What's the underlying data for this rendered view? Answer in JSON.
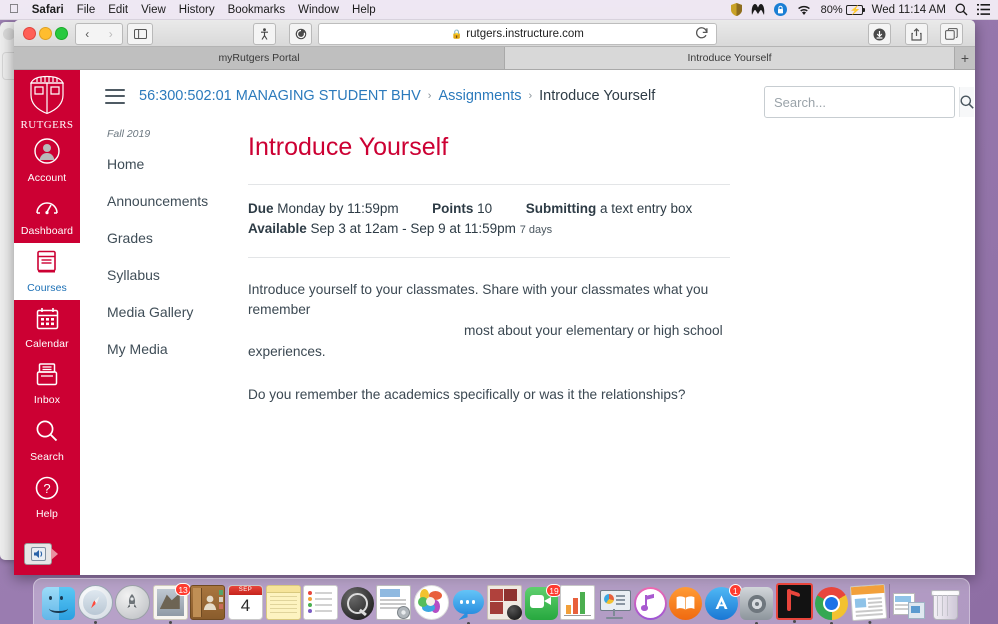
{
  "menubar": {
    "apple": "apple-logo",
    "items": [
      "Safari",
      "File",
      "Edit",
      "View",
      "History",
      "Bookmarks",
      "Window",
      "Help"
    ],
    "status": {
      "battery_percent": "80%",
      "clock": "Wed 11:14 AM",
      "icons": [
        "shield-icon",
        "malwarebytes-icon",
        "security-lock-icon",
        "wifi-icon",
        "battery-charging-icon",
        "spotlight-search-icon",
        "notification-center-icon"
      ]
    }
  },
  "browser": {
    "traffic_lights": [
      "close-button",
      "minimize-button",
      "zoom-button"
    ],
    "back_label": "‹",
    "forward_label": "›",
    "sidebar_icon": "sidebar-icon",
    "reader_icon": "reader-icon",
    "extension_icon": "extension-icon",
    "address": {
      "lock": "🔒",
      "url": "rutgers.instructure.com",
      "reload_icon": "reload-icon"
    },
    "right_buttons": [
      "downloads-icon",
      "share-icon",
      "show-all-tabs-icon"
    ],
    "tabs": [
      {
        "label": "myRutgers Portal",
        "active": false
      },
      {
        "label": "Introduce Yourself",
        "active": true
      }
    ],
    "new_tab_label": "+"
  },
  "global_nav": {
    "logo_text": "RUTGERS",
    "items": [
      {
        "label": "Account",
        "icon": "account-avatar-icon",
        "active": false
      },
      {
        "label": "Dashboard",
        "icon": "dashboard-gauge-icon",
        "active": false
      },
      {
        "label": "Courses",
        "icon": "courses-book-icon",
        "active": true
      },
      {
        "label": "Calendar",
        "icon": "calendar-icon",
        "active": false
      },
      {
        "label": "Inbox",
        "icon": "inbox-tray-icon",
        "active": false
      },
      {
        "label": "Search",
        "icon": "search-magnifier-icon",
        "active": false
      },
      {
        "label": "Help",
        "icon": "help-question-icon",
        "active": false
      }
    ],
    "accessibility_icon": "accessibility-speaker-icon"
  },
  "breadcrumb": {
    "menu_icon": "hamburger-menu-icon",
    "course": "56:300:502:01 MANAGING STUDENT BHV",
    "section": "Assignments",
    "current": "Introduce Yourself",
    "separator": "›"
  },
  "search": {
    "placeholder": "Search...",
    "icon": "search-icon"
  },
  "course_nav": {
    "term": "Fall 2019",
    "items": [
      "Home",
      "Announcements",
      "Grades",
      "Syllabus",
      "Media Gallery",
      "My Media"
    ]
  },
  "assignment": {
    "title": "Introduce Yourself",
    "due_label": "Due",
    "due_value": "Monday by 11:59pm",
    "points_label": "Points",
    "points_value": "10",
    "submitting_label": "Submitting",
    "submitting_value": "a text entry box",
    "available_label": "Available",
    "available_value": "Sep 3 at 12am - Sep 9 at 11:59pm",
    "available_duration": "7 days",
    "paragraph1_line1": "Introduce yourself to your classmates.  Share with your classmates what you remember",
    "paragraph1_line2": "most about your elementary or high school",
    "paragraph1_line3": "experiences.",
    "paragraph2": "Do you remember the academics specifically or was it the relationships?"
  },
  "dock": {
    "items": [
      {
        "name": "finder",
        "running": true
      },
      {
        "name": "safari",
        "running": true
      },
      {
        "name": "launchpad",
        "running": false
      },
      {
        "name": "mail",
        "running": true,
        "badge": "13"
      },
      {
        "name": "contacts",
        "running": false
      },
      {
        "name": "calendar",
        "running": false,
        "day": "4",
        "month": "SEP"
      },
      {
        "name": "notes",
        "running": false
      },
      {
        "name": "reminders",
        "running": false
      },
      {
        "name": "quicktime",
        "running": false
      },
      {
        "name": "automator-document",
        "running": false
      },
      {
        "name": "photos",
        "running": false
      },
      {
        "name": "messages",
        "running": true
      },
      {
        "name": "photo-booth",
        "running": false
      },
      {
        "name": "facetime",
        "running": false,
        "badge": "19"
      },
      {
        "name": "numbers",
        "running": false
      },
      {
        "name": "keynote",
        "running": false
      },
      {
        "name": "itunes",
        "running": false
      },
      {
        "name": "ibooks",
        "running": false
      },
      {
        "name": "app-store",
        "running": false,
        "badge": "1"
      },
      {
        "name": "system-preferences",
        "running": true
      },
      {
        "name": "adobe-acrobat",
        "running": true
      },
      {
        "name": "google-chrome",
        "running": true
      },
      {
        "name": "pages",
        "running": false
      },
      {
        "name": "documents-stack",
        "running": false
      },
      {
        "name": "trash",
        "running": false
      }
    ]
  },
  "colors": {
    "rutgers_red": "#cc0033",
    "canvas_link_blue": "#2b7abc",
    "body_text": "#2d3b45",
    "desktop_purple": "#9a7cb0"
  }
}
